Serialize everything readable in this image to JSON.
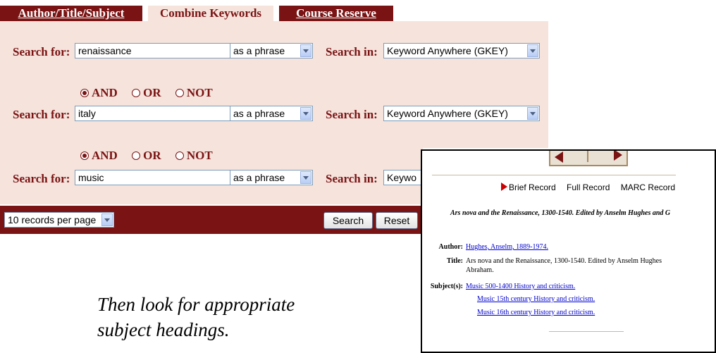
{
  "tabs": [
    {
      "label": "Author/Title/Subject"
    },
    {
      "label": "Combine Keywords"
    },
    {
      "label": "Course Reserve"
    }
  ],
  "search_rows": [
    {
      "label": "Search for:",
      "value": "renaissance",
      "mode": "as a phrase",
      "in_label": "Search in:",
      "in_value": "Keyword Anywhere (GKEY)"
    },
    {
      "label": "Search for:",
      "value": "italy",
      "mode": "as a phrase",
      "in_label": "Search in:",
      "in_value": "Keyword Anywhere (GKEY)"
    },
    {
      "label": "Search for:",
      "value": "music",
      "mode": "as a phrase",
      "in_label": "Search in:",
      "in_value": "Keywo"
    }
  ],
  "operators": {
    "and": "AND",
    "or": "OR",
    "not": "NOT",
    "selected": "AND"
  },
  "bottom": {
    "per_page": "10 records per page",
    "search_button": "Search",
    "reset_button": "Reset"
  },
  "caption": {
    "line1": "Then look for appropriate",
    "line2": "subject headings."
  },
  "record": {
    "nav": [
      "Brief Record",
      "Full Record",
      "MARC Record"
    ],
    "heading": "Ars nova and the Renaissance, 1300-1540. Edited by Anselm Hughes and G",
    "author_label": "Author:",
    "author": "Hughes, Anselm, 1889-1974.",
    "title_label": "Title:",
    "title_line1": "Ars nova and the Renaissance, 1300-1540. Edited by Anselm Hughes",
    "title_line2": "Abraham.",
    "subjects_label": "Subject(s):",
    "subjects": [
      "Music 500-1400 History and criticism.",
      "Music 15th century History and criticism.",
      "Music 16th century History and criticism."
    ]
  },
  "colors": {
    "accent": "#7a1313",
    "panel": "#f5e3dc",
    "link": "#0000cc"
  }
}
